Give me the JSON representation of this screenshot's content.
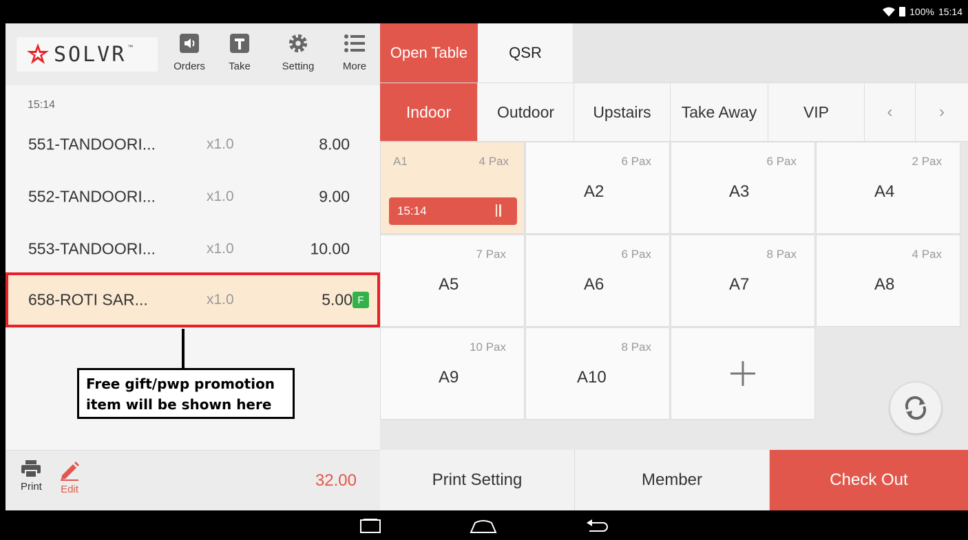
{
  "status_bar": {
    "battery": "100%",
    "time": "15:14"
  },
  "brand": {
    "logo_text": "SOLVR",
    "trademark": "™",
    "accent": "#e2574c"
  },
  "header_buttons": [
    {
      "label": "Orders",
      "icon": "speaker-icon"
    },
    {
      "label": "Take",
      "icon": "t-square-icon"
    },
    {
      "label": "Setting",
      "icon": "gear-icon"
    },
    {
      "label": "More",
      "icon": "list-icon"
    }
  ],
  "order": {
    "time": "15:14",
    "items": [
      {
        "name": "551-TANDOORI...",
        "qty": "x1.0",
        "price": "8.00"
      },
      {
        "name": "552-TANDOORI...",
        "qty": "x1.0",
        "price": "9.00"
      },
      {
        "name": "553-TANDOORI...",
        "qty": "x1.0",
        "price": "10.00"
      },
      {
        "name": "658-ROTI SAR...",
        "qty": "x1.0",
        "price": "5.00",
        "badge": "F"
      }
    ],
    "total": "32.00"
  },
  "callout": {
    "line1": "Free gift/pwp promotion",
    "line2": "item will be shown here"
  },
  "footer_left": {
    "print_label": "Print",
    "edit_label": "Edit"
  },
  "categories": [
    {
      "label": "Open Table",
      "active": true
    },
    {
      "label": "QSR",
      "active": false
    }
  ],
  "areas": [
    {
      "label": "Indoor",
      "active": true
    },
    {
      "label": "Outdoor"
    },
    {
      "label": "Upstairs"
    },
    {
      "label": "Take Away"
    },
    {
      "label": "VIP"
    }
  ],
  "area_nav": {
    "prev": "‹",
    "next": "›"
  },
  "tables": [
    {
      "name": "A1",
      "pax": "4 Pax",
      "occupied": true,
      "time": "15:14"
    },
    {
      "name": "A2",
      "pax": "6 Pax"
    },
    {
      "name": "A3",
      "pax": "6 Pax"
    },
    {
      "name": "A4",
      "pax": "2 Pax"
    },
    {
      "name": "A5",
      "pax": "7 Pax"
    },
    {
      "name": "A6",
      "pax": "6 Pax"
    },
    {
      "name": "A7",
      "pax": "8 Pax"
    },
    {
      "name": "A8",
      "pax": "4 Pax"
    },
    {
      "name": "A9",
      "pax": "10 Pax"
    },
    {
      "name": "A10",
      "pax": "8 Pax"
    }
  ],
  "bottom_actions": {
    "print_setting": "Print Setting",
    "member": "Member",
    "checkout": "Check Out"
  }
}
